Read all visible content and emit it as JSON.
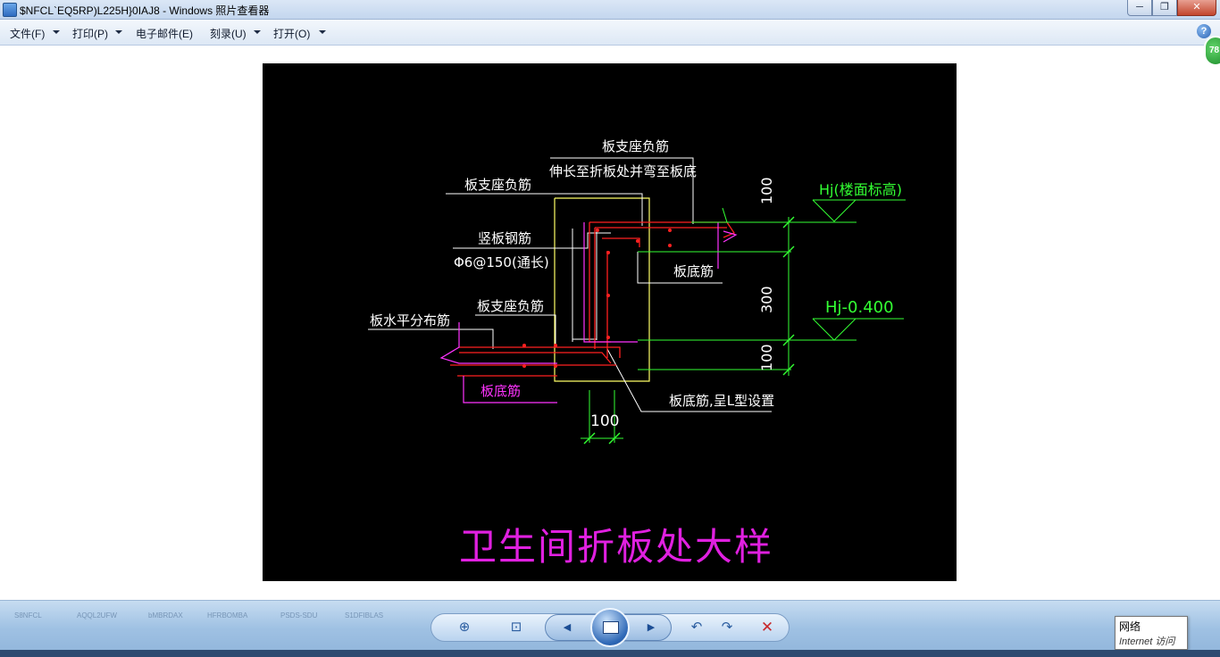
{
  "window": {
    "title": "$NFCL`EQ5RP)L225H}0IAJ8 - Windows 照片查看器",
    "min": "─",
    "max": "❐",
    "close": "✕"
  },
  "menu": {
    "file": "文件(F)",
    "print": "打印(P)",
    "email": "电子邮件(E)",
    "burn": "刻录(U)",
    "open": "打开(O)",
    "help": "?",
    "badge": "78"
  },
  "drawing": {
    "label_top_a": "板支座负筋",
    "label_top_b": "伸长至折板处并弯至板底",
    "label_left_top": "板支座负筋",
    "label_vertical": "竖板钢筋",
    "label_vertical_spec": "Φ6@150(通长)",
    "label_bottom_mid": "板底筋",
    "label_mid_neg": "板支座负筋",
    "label_horizontal_dist": "板水平分布筋",
    "label_bottom_left": "板底筋",
    "label_bottom_l": "板底筋,呈L型设置",
    "level_top": "Hj(楼面标高)",
    "level_mid": "Hj-0.400",
    "dim_100_top": "100",
    "dim_300": "300",
    "dim_100_bottom": "100",
    "dim_100_horizontal": "100",
    "caption": "卫生间折板处大样",
    "colors": {
      "white": "#ffffff",
      "yellow": "#ffff66",
      "red": "#ff2020",
      "magenta": "#ff33ff",
      "green": "#33ff33"
    }
  },
  "controls": {
    "zoom": "⊕",
    "fit": "⊡",
    "prev": "◀",
    "next": "▶",
    "rotate_left": "↶",
    "rotate_right": "↷",
    "delete": "✕"
  },
  "tooltip": {
    "line1": "网络",
    "line2": "Internet 访问"
  },
  "taskbar_ghosts": [
    "S8NFCL",
    "AQQL2UFW",
    "bMBRDAX",
    "HFRBOMBA",
    "PSDS-SDU",
    "S1DFIBLAS"
  ]
}
